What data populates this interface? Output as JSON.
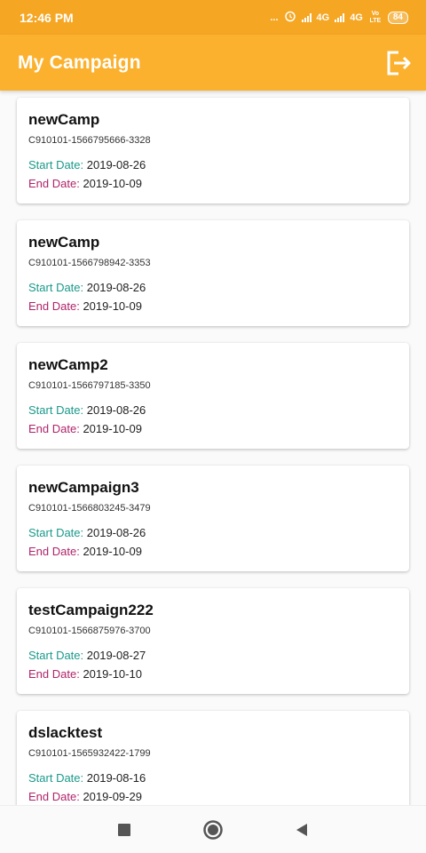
{
  "status_bar": {
    "time": "12:46 PM",
    "dots": "...",
    "network1": "4G",
    "network2": "4G",
    "volte": "Vo LTE",
    "battery": "84"
  },
  "app_bar": {
    "title": "My Campaign",
    "logout_icon": "logout-icon"
  },
  "labels": {
    "start": "Start Date:",
    "end": "End Date:"
  },
  "campaigns": [
    {
      "name": "newCamp",
      "id": "C910101-1566795666-3328",
      "start": "2019-08-26",
      "end": "2019-10-09"
    },
    {
      "name": "newCamp",
      "id": "C910101-1566798942-3353",
      "start": "2019-08-26",
      "end": "2019-10-09"
    },
    {
      "name": "newCamp2",
      "id": "C910101-1566797185-3350",
      "start": "2019-08-26",
      "end": "2019-10-09"
    },
    {
      "name": "newCampaign3",
      "id": "C910101-1566803245-3479",
      "start": "2019-08-26",
      "end": "2019-10-09"
    },
    {
      "name": "testCampaign222",
      "id": "C910101-1566875976-3700",
      "start": "2019-08-27",
      "end": "2019-10-10"
    },
    {
      "name": "dslacktest",
      "id": "C910101-1565932422-1799",
      "start": "2019-08-16",
      "end": "2019-09-29"
    }
  ],
  "nav": {
    "recents_icon": "square-icon",
    "home_icon": "circle-icon",
    "back_icon": "triangle-back-icon"
  },
  "colors": {
    "app_bar": "#fbb12e",
    "status_bar": "#f5a623",
    "start_label": "#1a9a8a",
    "end_label": "#b0236a"
  }
}
